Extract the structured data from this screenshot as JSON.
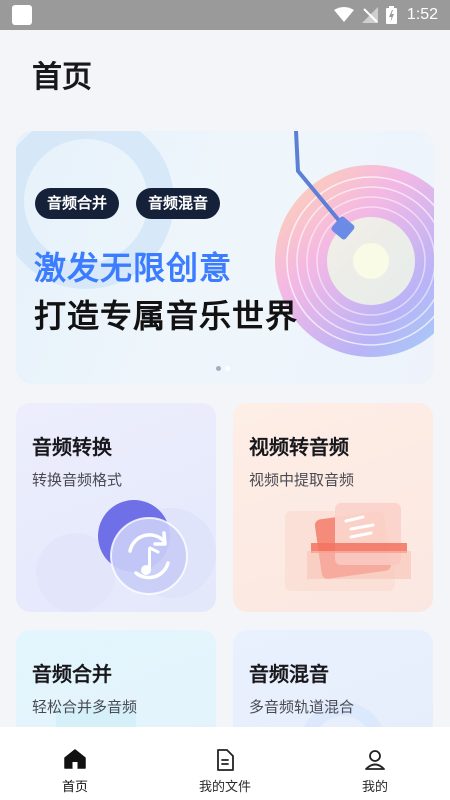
{
  "status_bar": {
    "time": "1:52"
  },
  "page": {
    "title": "首页"
  },
  "banner": {
    "tags": [
      "音频合并",
      "音频混音"
    ],
    "headline_line1": "激发无限创意",
    "headline_line2": "打造专属音乐世界"
  },
  "features": [
    {
      "title": "音频转换",
      "subtitle": "转换音频格式"
    },
    {
      "title": "视频转音频",
      "subtitle": "视频中提取音频"
    },
    {
      "title": "音频合并",
      "subtitle": "轻松合并多音频"
    },
    {
      "title": "音频混音",
      "subtitle": "多音频轨道混合"
    }
  ],
  "bottom_nav": [
    {
      "label": "首页",
      "icon": "home-icon",
      "active": true
    },
    {
      "label": "我的文件",
      "icon": "file-icon",
      "active": false
    },
    {
      "label": "我的",
      "icon": "profile-icon",
      "active": false
    }
  ],
  "colors": {
    "accent_blue": "#3c7dff",
    "tag_bg": "#142139"
  }
}
